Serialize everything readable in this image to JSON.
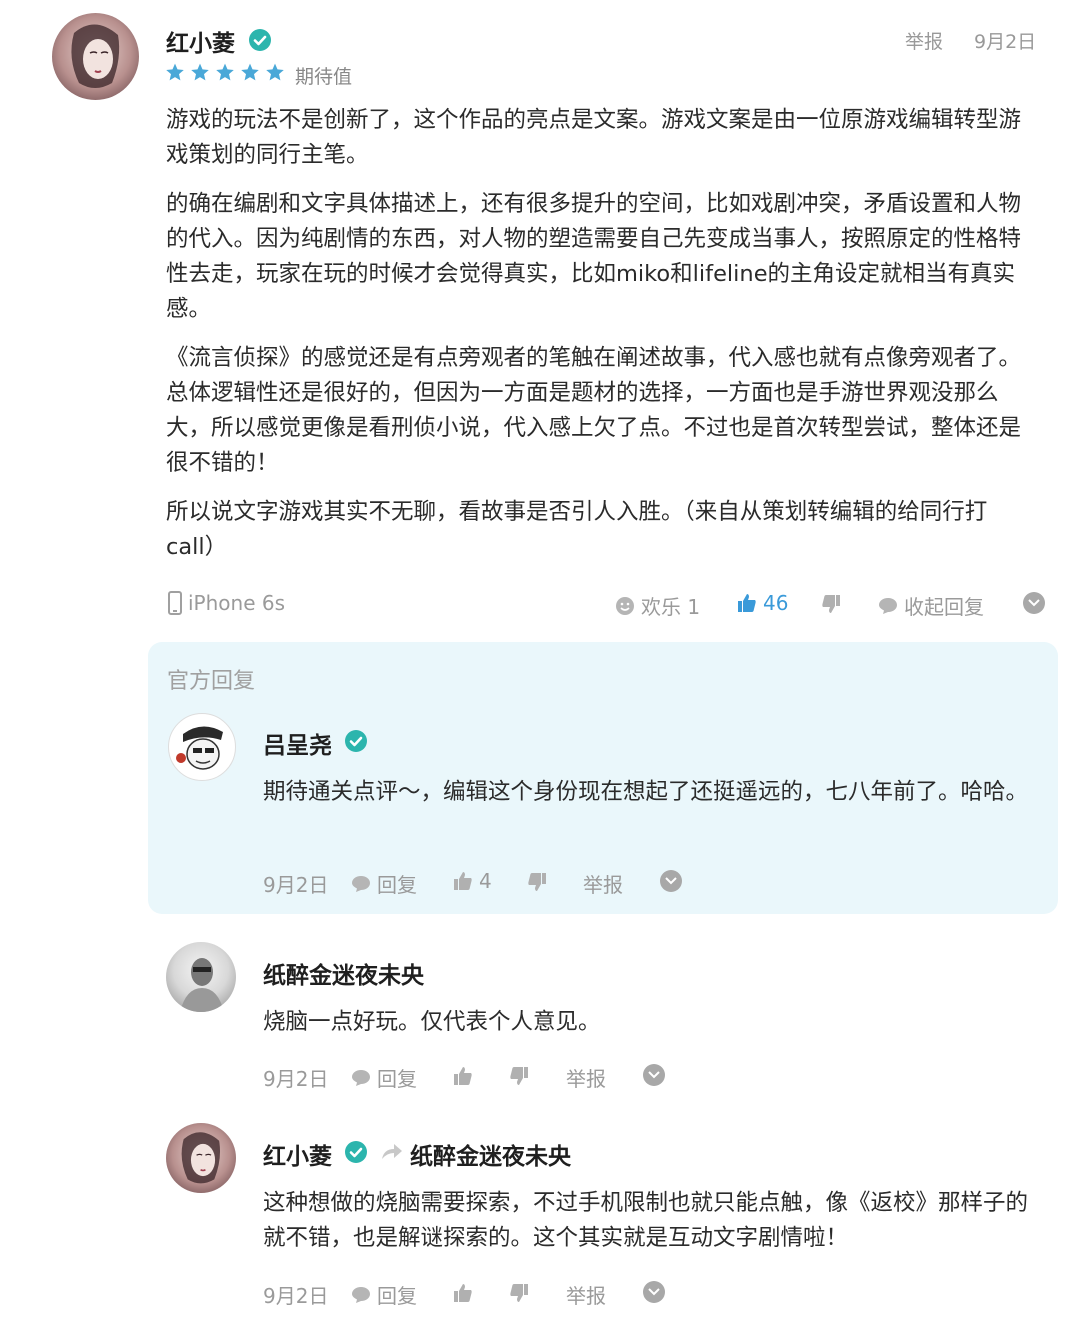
{
  "review": {
    "author": "红小菱",
    "rating_label": "期待值",
    "stars": 5,
    "report": "举报",
    "date": "9月2日",
    "paragraphs": [
      "游戏的玩法不是创新了，这个作品的亮点是文案。游戏文案是由一位原游戏编辑转型游戏策划的同行主笔。",
      "的确在编剧和文字具体描述上，还有很多提升的空间，比如戏剧冲突，矛盾设置和人物的代入。因为纯剧情的东西，对人物的塑造需要自己先变成当事人，按照原定的性格特性去走，玩家在玩的时候才会觉得真实，比如miko和lifeline的主角设定就相当有真实感。",
      "《流言侦探》的感觉还是有点旁观者的笔触在阐述故事，代入感也就有点像旁观者了。总体逻辑性还是很好的，但因为一方面是题材的选择，一方面也是手游世界观没那么大，所以感觉更像是看刑侦小说，代入感上欠了点。不过也是首次转型尝试，整体还是很不错的！",
      "所以说文字游戏其实不无聊，看故事是否引人入胜。（来自从策划转编辑的给同行打call）"
    ],
    "device": "iPhone 6s",
    "fun_label": "欢乐 1",
    "likes": "46",
    "collapse_label": "收起回复"
  },
  "official": {
    "title": "官方回复",
    "author": "吕呈尧",
    "text": "期待通关点评～，编辑这个身份现在想起了还挺遥远的，七八年前了。哈哈。",
    "date": "9月2日",
    "reply": "回复",
    "likes": "4",
    "report": "举报"
  },
  "replies": [
    {
      "author": "纸醉金迷夜未央",
      "text": "烧脑一点好玩。仅代表个人意见。",
      "date": "9月2日",
      "reply": "回复",
      "report": "举报"
    },
    {
      "author": "红小菱",
      "reply_to": "纸醉金迷夜未央",
      "text": "这种想做的烧脑需要探索，不过手机限制也就只能点触，像《返校》那样子的就不错，也是解谜探索的。这个其实就是互动文字剧情啦！",
      "date": "9月2日",
      "reply": "回复",
      "report": "举报"
    }
  ],
  "colors": {
    "accent": "#3a9ad9",
    "verified": "#2cb5ad",
    "star": "#4aa8d8",
    "official_bg": "#eaf7fb"
  }
}
